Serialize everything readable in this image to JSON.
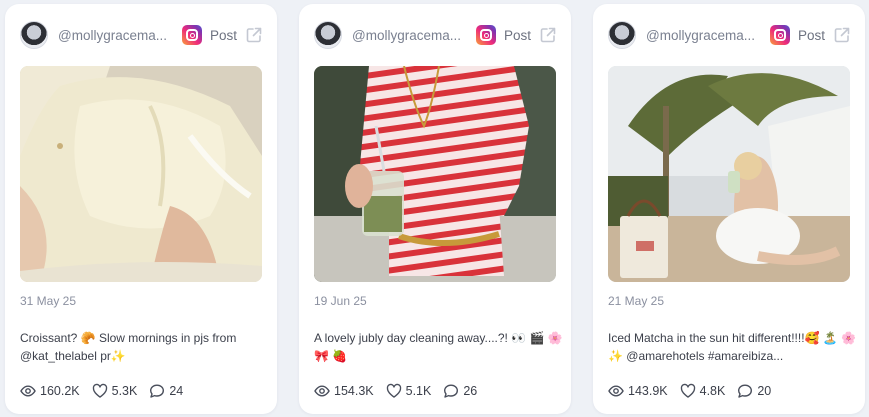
{
  "cards": [
    {
      "handle": "@mollygracema...",
      "platform_icon": "instagram-icon",
      "post_label": "Post",
      "date": "31 May 25",
      "caption": "Croissant? 🥐 Slow mornings in pjs from @kat_thelabel pr✨",
      "views": "160.2K",
      "likes": "5.3K",
      "comments": "24"
    },
    {
      "handle": "@mollygracema...",
      "platform_icon": "instagram-icon",
      "post_label": "Post",
      "date": "19 Jun 25",
      "caption": "A lovely jubly day cleaning away....?! 👀 🎬 🌸 🎀 🍓",
      "views": "154.3K",
      "likes": "5.1K",
      "comments": "26"
    },
    {
      "handle": "@mollygracema...",
      "platform_icon": "instagram-icon",
      "post_label": "Post",
      "date": "21 May 25",
      "caption": "Iced Matcha in the sun hit different!!!!🥰 🏝️ 🌸 ✨ @amarehotels #amareibiza...",
      "views": "143.9K",
      "likes": "4.8K",
      "comments": "20"
    }
  ],
  "colors": {
    "background": "#eef1f6",
    "card": "#ffffff",
    "muted_text": "#8b90a0",
    "body_text": "#3b3f4a"
  }
}
